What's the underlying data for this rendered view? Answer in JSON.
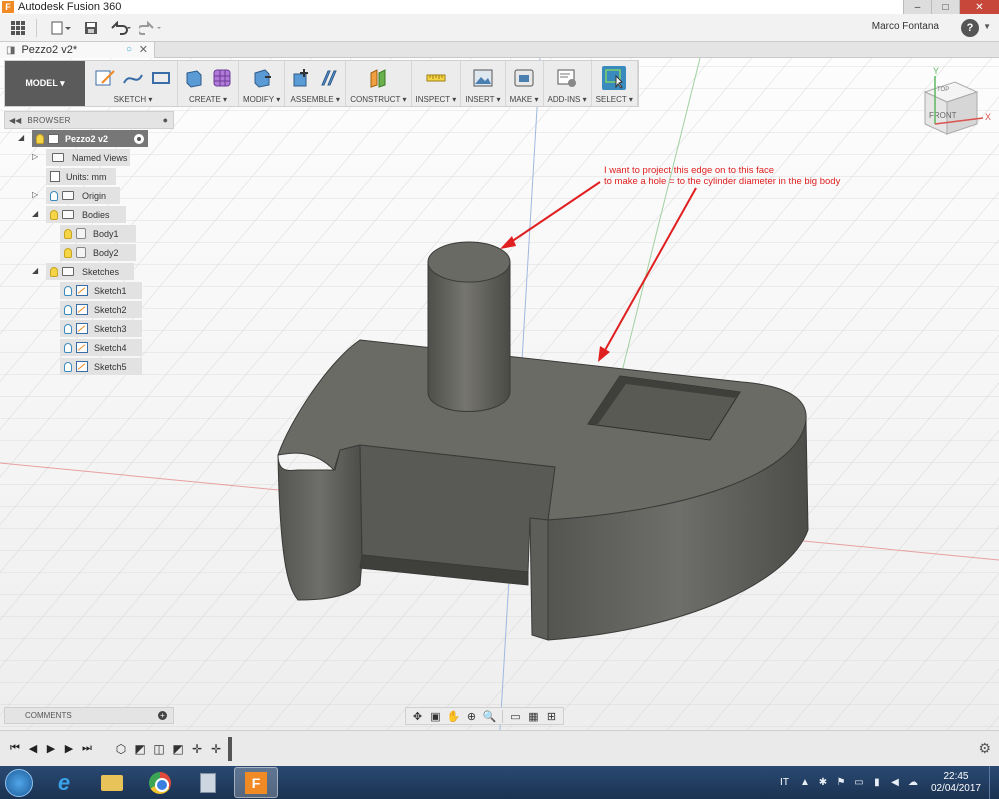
{
  "window": {
    "app_icon": "F",
    "title": "Autodesk Fusion 360",
    "minimize": "–",
    "maximize": "□",
    "close": "✕"
  },
  "quickbar": {
    "user_name": "Marco Fontana",
    "help_label": "?"
  },
  "document_tab": {
    "label": "Pezzo2 v2*"
  },
  "toolbar": {
    "workspace": "MODEL ▾",
    "groups": [
      {
        "label": "SKETCH ▾"
      },
      {
        "label": "CREATE ▾"
      },
      {
        "label": "MODIFY ▾"
      },
      {
        "label": "ASSEMBLE ▾"
      },
      {
        "label": "CONSTRUCT ▾"
      },
      {
        "label": "INSPECT ▾"
      },
      {
        "label": "INSERT ▾"
      },
      {
        "label": "MAKE ▾"
      },
      {
        "label": "ADD-INS ▾"
      },
      {
        "label": "SELECT ▾"
      }
    ]
  },
  "browser": {
    "title": "BROWSER",
    "root": "Pezzo2 v2",
    "items": [
      {
        "label": "Named Views"
      },
      {
        "label": "Units: mm"
      },
      {
        "label": "Origin"
      },
      {
        "label": "Bodies"
      },
      {
        "label": "Body1"
      },
      {
        "label": "Body2"
      },
      {
        "label": "Sketches"
      },
      {
        "label": "Sketch1"
      },
      {
        "label": "Sketch2"
      },
      {
        "label": "Sketch3"
      },
      {
        "label": "Sketch4"
      },
      {
        "label": "Sketch5"
      }
    ]
  },
  "annotation": {
    "line1": "I want to project this edge on to this face",
    "line2": "to make a hole = to the cylinder diameter in the big body",
    "color": "#e02020"
  },
  "viewcube": {
    "front": "FRONT",
    "top": "TOP",
    "axis_x": "X",
    "axis_y": "Y",
    "axis_z": "Z"
  },
  "comments": {
    "title": "COMMENTS"
  },
  "taskbar": {
    "language": "IT",
    "time": "22:45",
    "date": "02/04/2017"
  }
}
